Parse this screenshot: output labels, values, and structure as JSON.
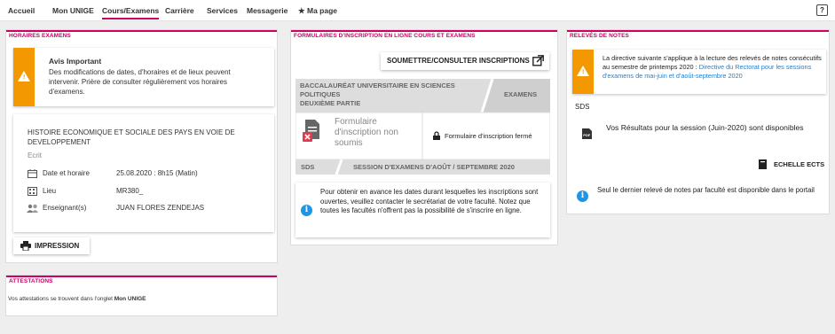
{
  "nav": {
    "items": [
      "Accueil",
      "Mon UNIGE",
      "Cours/Examens",
      "Carrière",
      "Services",
      "Messagerie",
      "Ma page"
    ],
    "help_label": "?"
  },
  "horaires": {
    "title": "HORAIRES EXAMENS",
    "warning_title": "Avis Important",
    "warning_text": "Des modifications de dates, d'horaires et de lieux peuvent intervenir. Prière de consulter régulièrement vos horaires d'examens.",
    "course_title": "HISTOIRE ECONOMIQUE ET SOCIALE DES PAYS EN VOIE DE DEVELOPPEMENT",
    "course_type": "Ecrit",
    "date_label": "Date et horaire",
    "date_value": "25.08.2020 : 8h15 (Matin)",
    "lieu_label": "Lieu",
    "lieu_value": "MR380_",
    "teacher_label": "Enseignant(s)",
    "teacher_value": "JUAN FLORES ZENDEJAS",
    "print_label": "IMPRESSION"
  },
  "attestations": {
    "title": "ATTESTATIONS",
    "text": "Vos attestations se trouvent dans l'onglet ",
    "text_bold": "Mon UNIGE"
  },
  "formulaires": {
    "title": "FORMULAIRES D'INSCRIPTION EN LIGNE COURS ET EXAMENS",
    "submit_label": "SOUMETTRE/CONSULTER INSCRIPTIONS",
    "program_line1": "BACCALAURÉAT UNIVERSITAIRE EN SCIENCES",
    "program_line2": "POLITIQUES",
    "program_line3": "DEUXIÈME PARTIE",
    "exams_label": "EXAMENS",
    "form_status_line1": "Formulaire",
    "form_status_line2": "d'inscription non",
    "form_status_line3": "soumis",
    "form_closed": "Formulaire d'inscription fermé",
    "sds_label": "SDS",
    "session_label": "SESSION D'EXAMENS D'AOÛT / SEPTEMBRE 2020",
    "info_text": "Pour obtenir en avance les dates durant lesquelles les inscriptions sont ouvertes, veuillez contacter le secrétariat de votre faculté. Notez que toutes les facultés n'offrent pas la possibilité de s'inscrire en ligne."
  },
  "releves": {
    "title": "RELEVÉS DE NOTES",
    "warning_text": "La directive suivante s'applique à la lecture des relevés de notes consécutifs au semestre de printemps 2020 : ",
    "warning_link": "Directive du Rectorat pour les sessions d'examens de mai-juin et d'août-septembre 2020",
    "sds_label": "SDS",
    "results_text": "Vos Résultats pour la session (Juin-2020) sont disponibles",
    "pdf_label": "PDF",
    "ects_label": "ECHELLE ECTS",
    "info_text": "Seul le dernier relevé de notes par faculté est disponible dans le portail"
  },
  "colors": {
    "accent": "#cf0063",
    "warning": "#f39800",
    "info": "#1e96e6"
  }
}
